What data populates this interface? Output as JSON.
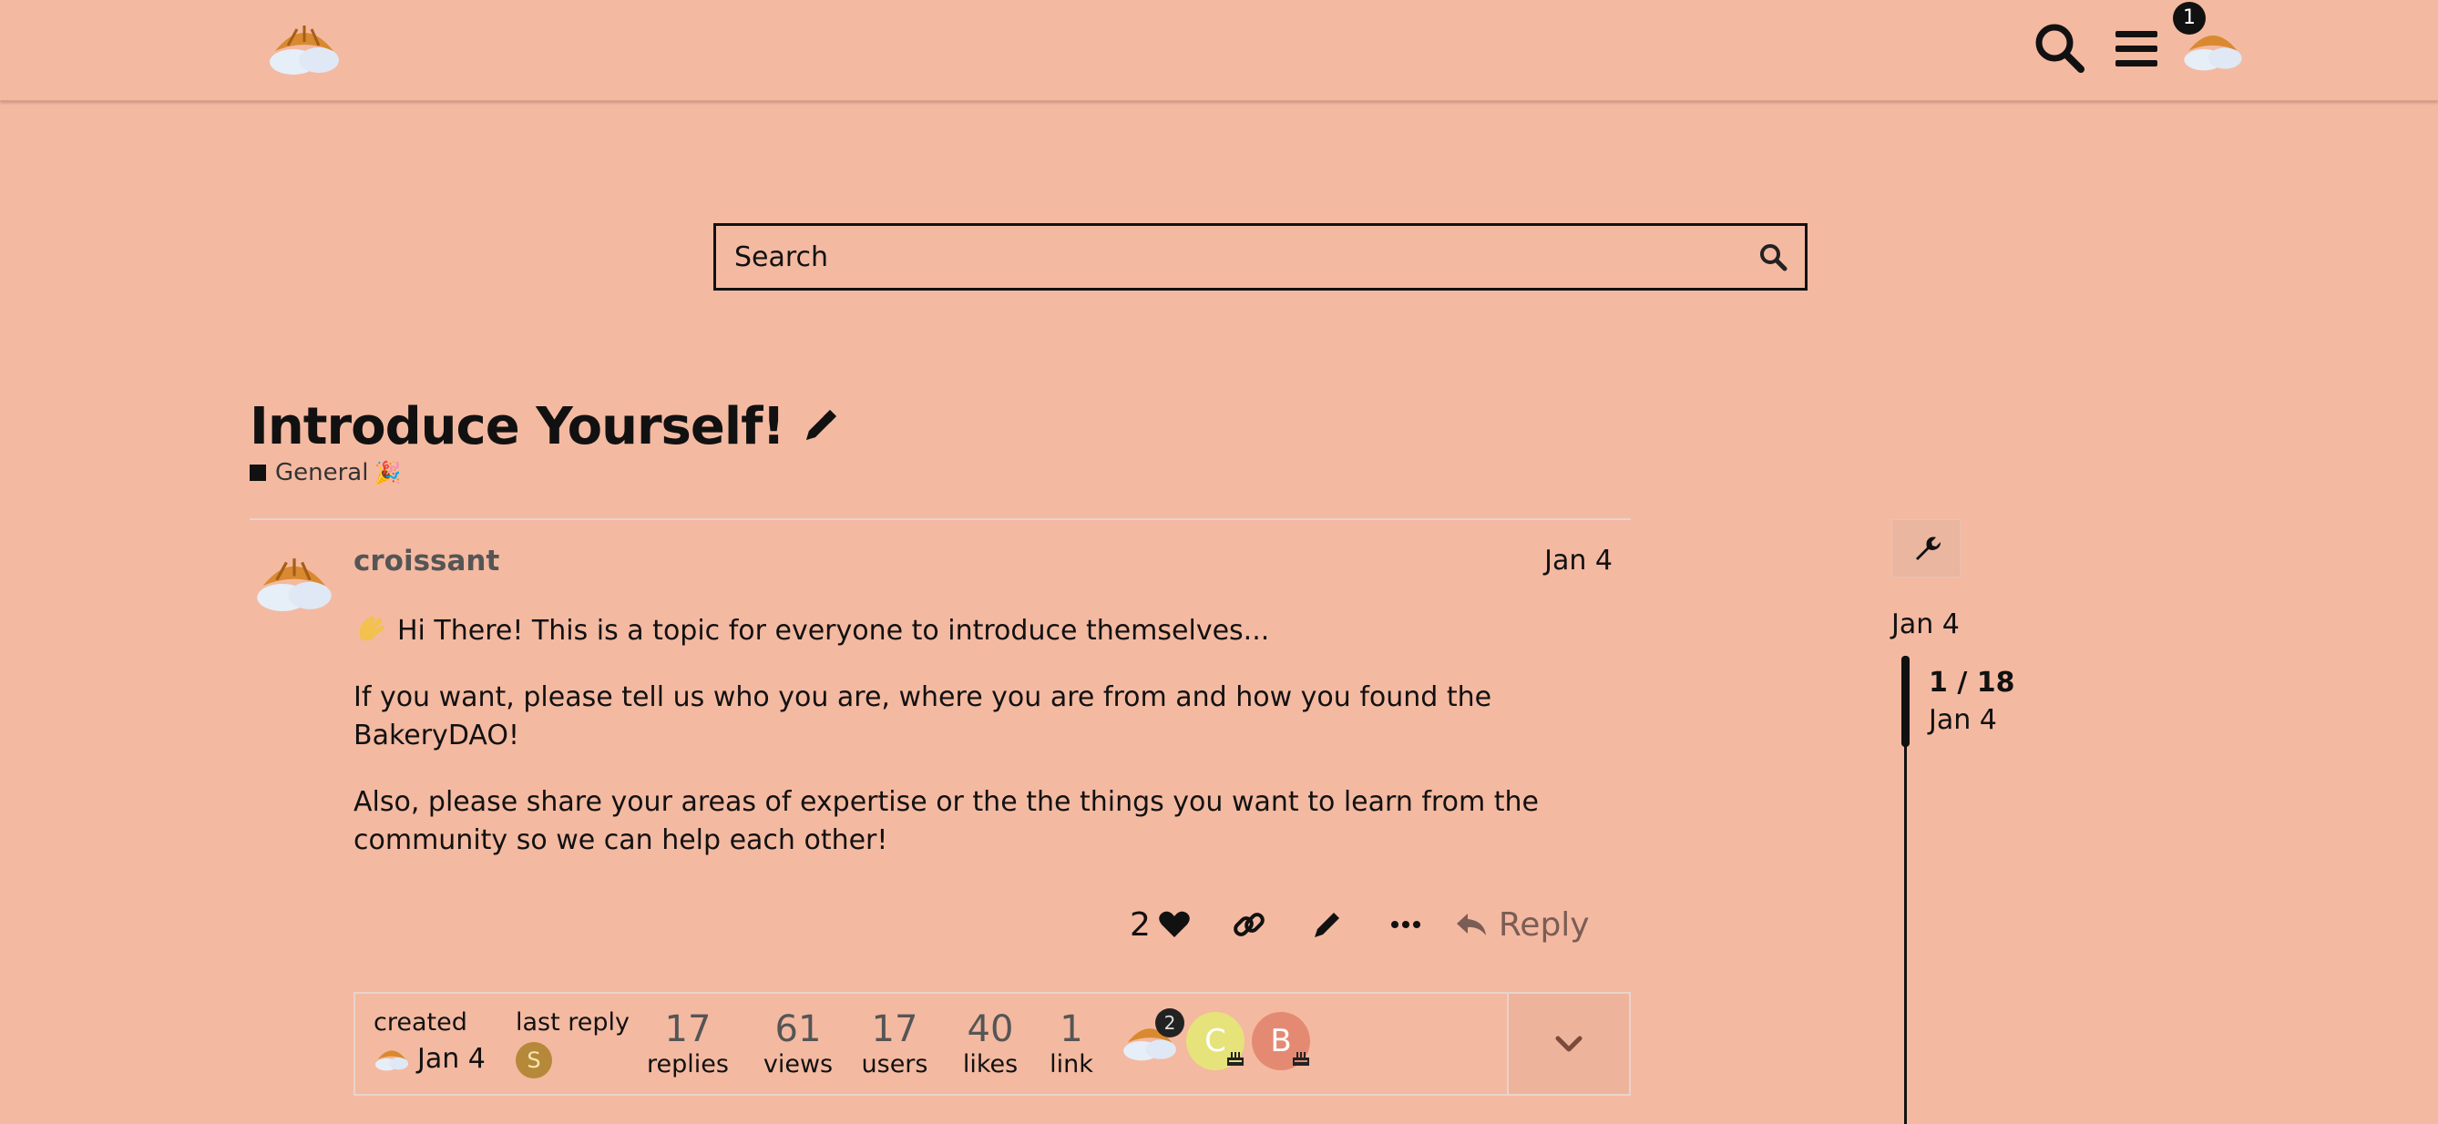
{
  "header": {
    "logo_icon": "croissant-cloud-logo",
    "search_icon": "search-icon",
    "menu_icon": "hamburger-menu-icon",
    "notification_count": "1"
  },
  "search": {
    "placeholder": "Search"
  },
  "topic": {
    "title": "Introduce Yourself!",
    "category": "General",
    "category_emoji": "🎉",
    "category_color": "#111111"
  },
  "post": {
    "username": "croissant",
    "date": "Jan 4",
    "paragraphs": [
      "Hi There! This is a topic for everyone to introduce themselves...",
      "If you want, please tell us who you are, where you are from and how you found the BakeryDAO!",
      "Also, please share your areas of expertise or the the things you want to learn from the community so we can help each other!"
    ],
    "like_count": "2",
    "reply_label": "Reply"
  },
  "topic_map": {
    "created_label": "created",
    "created_date": "Jan 4",
    "last_reply_label": "last reply",
    "last_reply_initial": "S",
    "stats": [
      {
        "value": "17",
        "label": "replies"
      },
      {
        "value": "61",
        "label": "views"
      },
      {
        "value": "17",
        "label": "users"
      },
      {
        "value": "40",
        "label": "likes"
      },
      {
        "value": "1",
        "label": "link"
      }
    ],
    "participants": [
      {
        "initial": "",
        "count": "2",
        "color": "#f4b9a1"
      },
      {
        "initial": "C",
        "color": "#e6e37a"
      },
      {
        "initial": "B",
        "color": "#e48a73"
      }
    ]
  },
  "timeline": {
    "start_date": "Jan 4",
    "position": "1 / 18",
    "position_date": "Jan 4"
  },
  "colors": {
    "background": "#f4b9a1",
    "text": "#111111"
  }
}
